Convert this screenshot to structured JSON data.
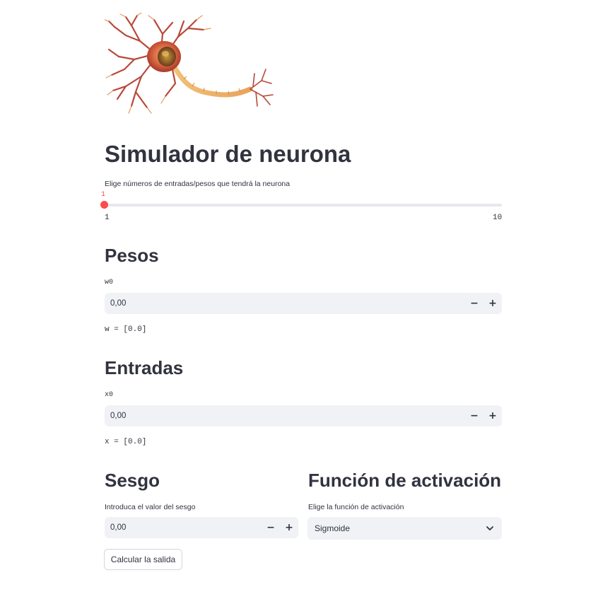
{
  "header": {
    "title": "Simulador de neurona",
    "image_icon": "neuron-illustration"
  },
  "slider": {
    "label": "Elige números de entradas/pesos que tendrá la neurona",
    "value": "1",
    "min_label": "1",
    "max_label": "10",
    "min": 1,
    "max": 10,
    "current": 1,
    "accent_color": "#ff4b4b"
  },
  "weights": {
    "heading": "Pesos",
    "field_label": "w0",
    "value": "0,00",
    "minus": "−",
    "plus": "+",
    "output": "w = [0.0]"
  },
  "inputs": {
    "heading": "Entradas",
    "field_label": "x0",
    "value": "0,00",
    "minus": "−",
    "plus": "+",
    "output": "x = [0.0]"
  },
  "bias": {
    "heading": "Sesgo",
    "field_label": "Introduca el valor del sesgo",
    "value": "0,00",
    "minus": "−",
    "plus": "+"
  },
  "activation": {
    "heading": "Función de activación",
    "field_label": "Elige la función de activación",
    "selected": "Sigmoide",
    "icon": "chevron-down-icon"
  },
  "actions": {
    "compute_label": "Calcular la salida"
  },
  "colors": {
    "text": "#31333f",
    "input_bg": "#f0f2f6",
    "accent": "#ff4b4b"
  }
}
